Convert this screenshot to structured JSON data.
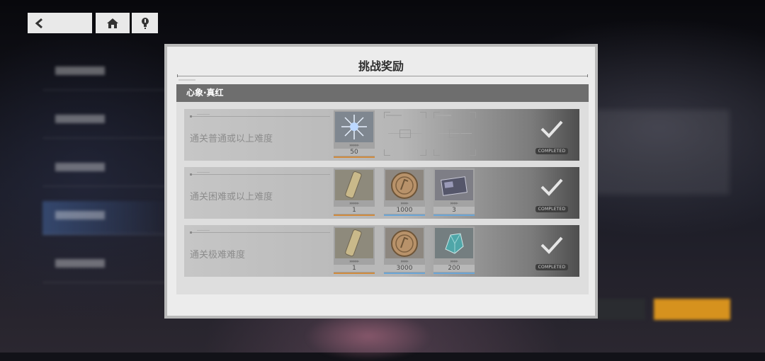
{
  "modal": {
    "title": "挑战奖励",
    "section_title": "心象·真红"
  },
  "rows": [
    {
      "label": "通关普通或以上难度",
      "status": "COMPLETED",
      "rewards": [
        {
          "icon": "crystal-shard-icon",
          "qty": "50",
          "rarity": "orange"
        }
      ],
      "empty_slots": 2
    },
    {
      "label": "通关困难或以上难度",
      "status": "COMPLETED",
      "rewards": [
        {
          "icon": "golden-scroll-icon",
          "qty": "1",
          "rarity": "orange"
        },
        {
          "icon": "coin-icon",
          "qty": "1000",
          "rarity": "blue"
        },
        {
          "icon": "memory-card-icon",
          "qty": "3",
          "rarity": "blue"
        }
      ]
    },
    {
      "label": "通关极难难度",
      "status": "COMPLETED",
      "rewards": [
        {
          "icon": "golden-scroll-icon",
          "qty": "1",
          "rarity": "orange"
        },
        {
          "icon": "coin-icon",
          "qty": "3000",
          "rarity": "blue"
        },
        {
          "icon": "cyan-gem-icon",
          "qty": "200",
          "rarity": "blue"
        }
      ]
    }
  ],
  "nav": {
    "icons": [
      "back-arrow-icon",
      "home-icon",
      "hint-bulb-icon"
    ]
  }
}
